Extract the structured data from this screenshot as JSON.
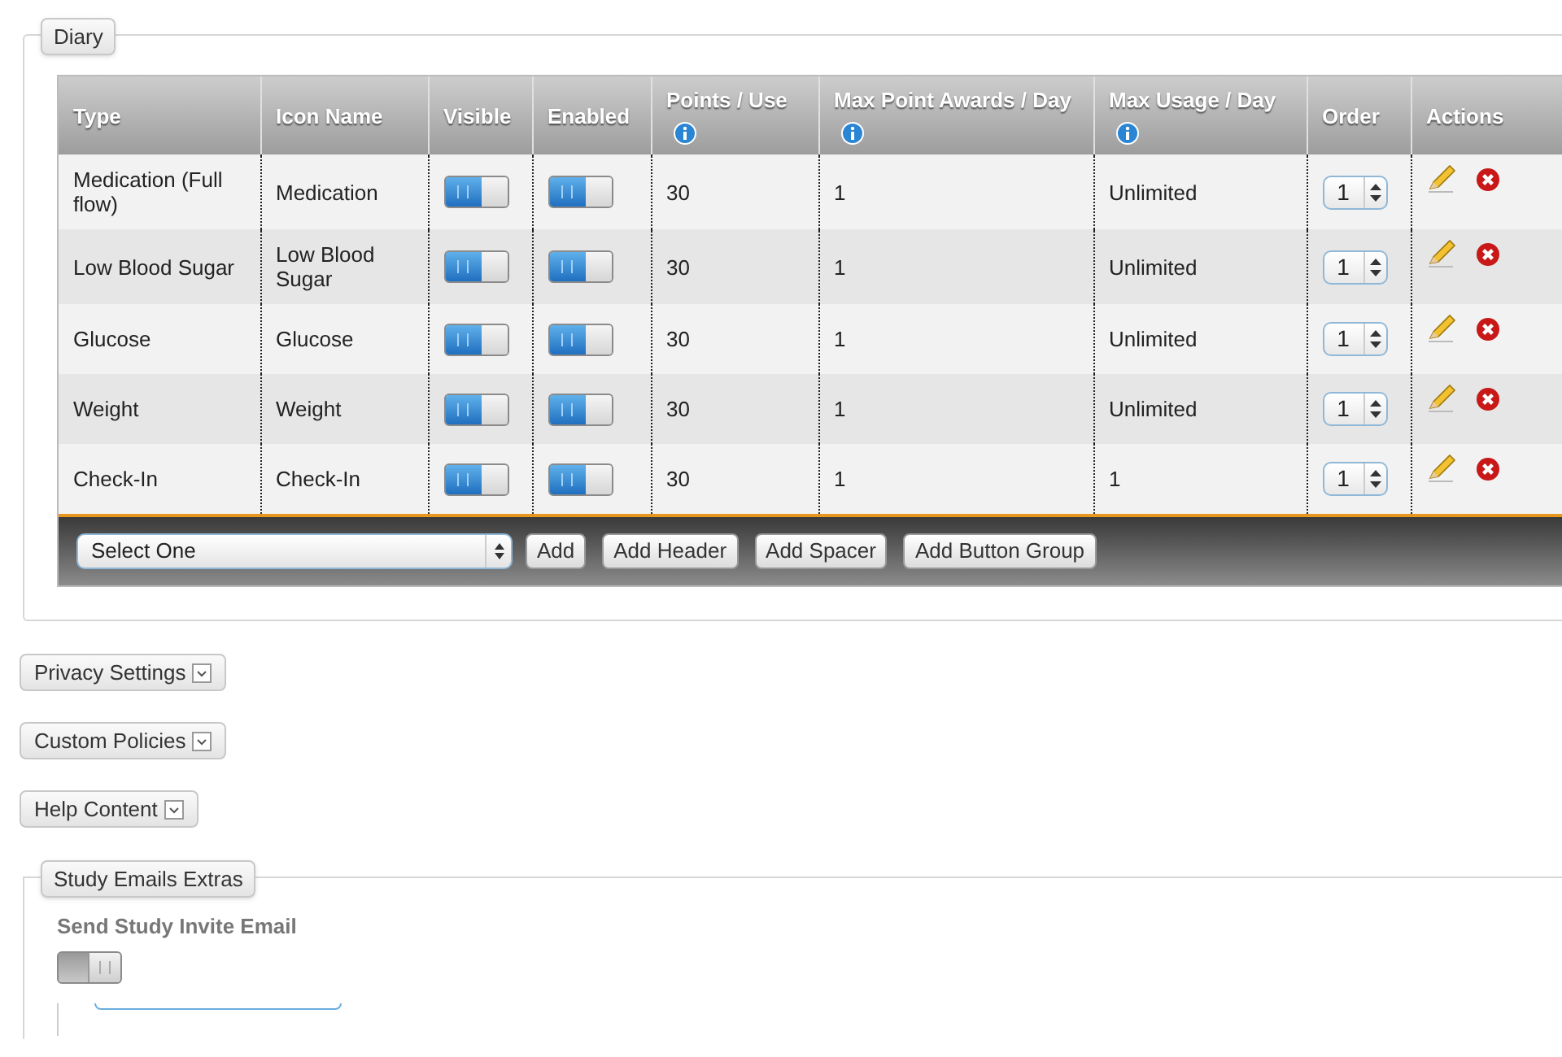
{
  "diary": {
    "legend": "Diary",
    "columns": [
      {
        "label": "Type",
        "info": false
      },
      {
        "label": "Icon Name",
        "info": false
      },
      {
        "label": "Visible",
        "info": false
      },
      {
        "label": "Enabled",
        "info": false
      },
      {
        "label": "Points / Use",
        "info": true
      },
      {
        "label": "Max Point Awards / Day",
        "info": true
      },
      {
        "label": "Max Usage / Day",
        "info": true
      },
      {
        "label": "Order",
        "info": false
      },
      {
        "label": "Actions",
        "info": false
      }
    ],
    "rows": [
      {
        "type": "Medication (Full flow)",
        "icon_name": "Medication",
        "visible": true,
        "enabled": true,
        "points": "30",
        "max_awards": "1",
        "max_usage": "Unlimited",
        "order": "1"
      },
      {
        "type": "Low Blood Sugar",
        "icon_name": "Low Blood Sugar",
        "visible": true,
        "enabled": true,
        "points": "30",
        "max_awards": "1",
        "max_usage": "Unlimited",
        "order": "1"
      },
      {
        "type": "Glucose",
        "icon_name": "Glucose",
        "visible": true,
        "enabled": true,
        "points": "30",
        "max_awards": "1",
        "max_usage": "Unlimited",
        "order": "1"
      },
      {
        "type": "Weight",
        "icon_name": "Weight",
        "visible": true,
        "enabled": true,
        "points": "30",
        "max_awards": "1",
        "max_usage": "Unlimited",
        "order": "1"
      },
      {
        "type": "Check-In",
        "icon_name": "Check-In",
        "visible": true,
        "enabled": true,
        "points": "30",
        "max_awards": "1",
        "max_usage": "1",
        "order": "1"
      }
    ],
    "footer": {
      "select": "Select One",
      "buttons": [
        "Add",
        "Add Header",
        "Add Spacer",
        "Add Button Group"
      ]
    }
  },
  "sections": [
    {
      "label": "Privacy Settings",
      "expanded": false
    },
    {
      "label": "Custom Policies",
      "expanded": false
    },
    {
      "label": "Help Content",
      "expanded": false
    }
  ],
  "study_emails": {
    "legend": "Study Emails Extras",
    "field_label": "Send Study Invite Email",
    "send_invite_on": false
  }
}
